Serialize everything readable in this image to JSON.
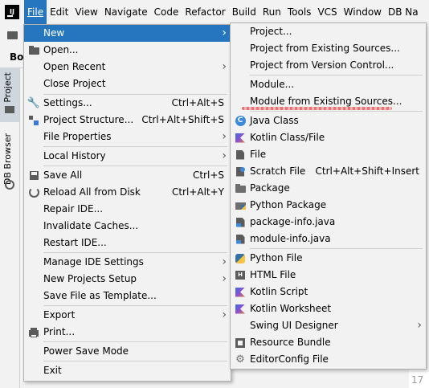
{
  "menubar": {
    "logo": "IJ",
    "items": [
      "File",
      "Edit",
      "View",
      "Navigate",
      "Code",
      "Refactor",
      "Build",
      "Run",
      "Tools",
      "VCS",
      "Window",
      "DB Na"
    ]
  },
  "ide": {
    "tab_fragment": "Bo",
    "sidebar_tabs": [
      "Project",
      "DB Browser"
    ],
    "line_number": "17"
  },
  "file_menu": {
    "items": [
      {
        "label": "New",
        "shortcut": "",
        "submenu": true,
        "highlighted": true,
        "icon": ""
      },
      {
        "label": "Open...",
        "shortcut": "",
        "icon": "folder-icon"
      },
      {
        "label": "Open Recent",
        "shortcut": "",
        "submenu": true,
        "icon": ""
      },
      {
        "label": "Close Project",
        "shortcut": "",
        "icon": ""
      },
      {
        "label": "Settings...",
        "shortcut": "Ctrl+Alt+S",
        "icon": "wrench-icon"
      },
      {
        "label": "Project Structure...",
        "shortcut": "Ctrl+Alt+Shift+S",
        "icon": "project-structure-icon"
      },
      {
        "label": "File Properties",
        "shortcut": "",
        "submenu": true,
        "icon": ""
      },
      {
        "label": "Local History",
        "shortcut": "",
        "submenu": true,
        "icon": ""
      },
      {
        "label": "Save All",
        "shortcut": "Ctrl+S",
        "icon": "save-icon"
      },
      {
        "label": "Reload All from Disk",
        "shortcut": "Ctrl+Alt+Y",
        "icon": "reload-icon"
      },
      {
        "label": "Repair IDE...",
        "shortcut": "",
        "icon": ""
      },
      {
        "label": "Invalidate Caches...",
        "shortcut": "",
        "icon": ""
      },
      {
        "label": "Restart IDE...",
        "shortcut": "",
        "icon": ""
      },
      {
        "label": "Manage IDE Settings",
        "shortcut": "",
        "submenu": true,
        "icon": ""
      },
      {
        "label": "New Projects Setup",
        "shortcut": "",
        "submenu": true,
        "icon": ""
      },
      {
        "label": "Save File as Template...",
        "shortcut": "",
        "icon": ""
      },
      {
        "label": "Export",
        "shortcut": "",
        "submenu": true,
        "icon": ""
      },
      {
        "label": "Print...",
        "shortcut": "",
        "icon": "print-icon"
      },
      {
        "label": "Power Save Mode",
        "shortcut": "",
        "icon": ""
      },
      {
        "label": "Exit",
        "shortcut": "",
        "icon": ""
      }
    ]
  },
  "new_menu": {
    "items": [
      {
        "label": "Project...",
        "shortcut": "",
        "icon": ""
      },
      {
        "label": "Project from Existing Sources...",
        "shortcut": "",
        "icon": ""
      },
      {
        "label": "Project from Version Control...",
        "shortcut": "",
        "icon": ""
      },
      {
        "label": "Module...",
        "shortcut": "",
        "icon": ""
      },
      {
        "label": "Module from Existing Sources...",
        "shortcut": "",
        "icon": ""
      },
      {
        "label": "Java Class",
        "shortcut": "",
        "icon": "java-class-icon"
      },
      {
        "label": "Kotlin Class/File",
        "shortcut": "",
        "icon": "kotlin-icon"
      },
      {
        "label": "File",
        "shortcut": "",
        "icon": "file-icon"
      },
      {
        "label": "Scratch File",
        "shortcut": "Ctrl+Alt+Shift+Insert",
        "icon": "scratch-file-icon"
      },
      {
        "label": "Package",
        "shortcut": "",
        "icon": "package-icon"
      },
      {
        "label": "Python Package",
        "shortcut": "",
        "icon": "python-package-icon"
      },
      {
        "label": "package-info.java",
        "shortcut": "",
        "icon": "java-file-icon"
      },
      {
        "label": "module-info.java",
        "shortcut": "",
        "icon": "java-file-icon"
      },
      {
        "label": "Python File",
        "shortcut": "",
        "icon": "python-icon"
      },
      {
        "label": "HTML File",
        "shortcut": "",
        "icon": "html-icon"
      },
      {
        "label": "Kotlin Script",
        "shortcut": "",
        "icon": "kotlin-icon"
      },
      {
        "label": "Kotlin Worksheet",
        "shortcut": "",
        "icon": "kotlin-icon"
      },
      {
        "label": "Swing UI Designer",
        "shortcut": "",
        "submenu": true,
        "icon": ""
      },
      {
        "label": "Resource Bundle",
        "shortcut": "",
        "icon": "resource-bundle-icon"
      },
      {
        "label": "EditorConfig File",
        "shortcut": "",
        "icon": "gear-icon"
      }
    ]
  },
  "colors": {
    "highlight": "#2675bf",
    "menu_bg": "#f2f2f2"
  }
}
